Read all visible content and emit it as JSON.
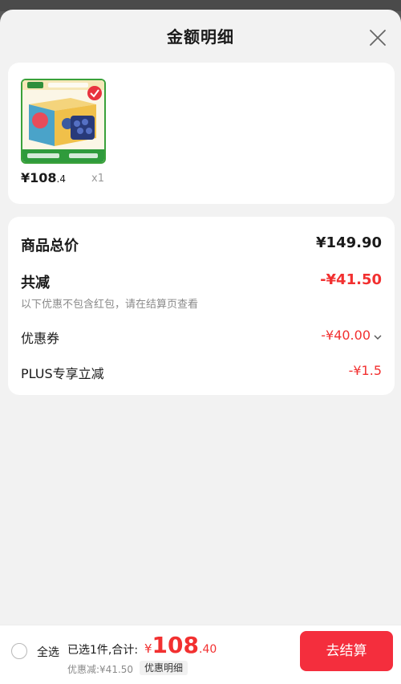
{
  "sheet": {
    "title": "金额明细"
  },
  "product": {
    "price_main": "¥108",
    "price_decimal": ".4",
    "quantity": "x1",
    "thumb_icon": "blueberry-gift-box-image"
  },
  "summary": {
    "goods_total_label": "商品总价",
    "goods_total_value": "¥149.90",
    "total_discount_label": "共减",
    "total_discount_value": "-¥41.50",
    "note": "以下优惠不包含红包，请在结算页查看",
    "coupon_label": "优惠券",
    "coupon_value": "-¥40.00",
    "plus_label": "PLUS专享立减",
    "plus_value": "-¥1.5"
  },
  "bottom": {
    "select_all": "全选",
    "selected_count": "已选1件,合计:",
    "total_symbol": "¥",
    "total_int": "108",
    "total_dec": ".40",
    "discount_line": "优惠减:¥41.50",
    "detail_button": "优惠明细",
    "checkout_button": "去结算"
  },
  "colors": {
    "accent_red": "#f23030",
    "checkout_bg": "#f42e3d"
  }
}
